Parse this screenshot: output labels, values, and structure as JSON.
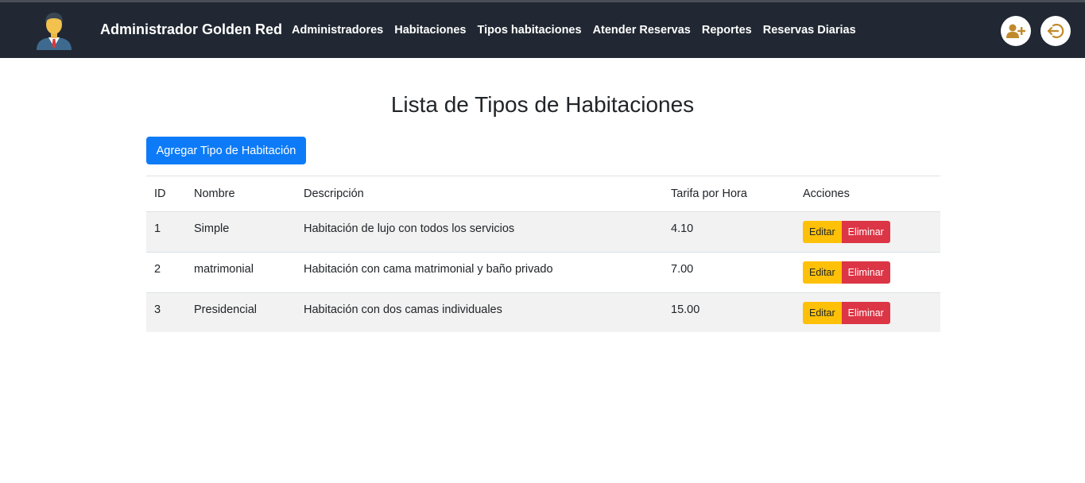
{
  "navbar": {
    "brand": "Administrador Golden Red",
    "links": [
      "Administradores",
      "Habitaciones",
      "Tipos habitaciones",
      "Atender Reservas",
      "Reportes",
      "Reservas Diarias"
    ],
    "add_user_icon": "user-plus-icon",
    "logout_icon": "logout-icon",
    "accent_color": "#c08a2a"
  },
  "main": {
    "title": "Lista de Tipos de Habitaciones",
    "add_button": "Agregar Tipo de Habitación",
    "table": {
      "headers": [
        "ID",
        "Nombre",
        "Descripción",
        "Tarifa por Hora",
        "Acciones"
      ],
      "rows": [
        {
          "id": "1",
          "nombre": "Simple",
          "descripcion": "Habitación de lujo con todos los servicios",
          "tarifa": "4.10"
        },
        {
          "id": "2",
          "nombre": "matrimonial",
          "descripcion": "Habitación con cama matrimonial y baño privado",
          "tarifa": "7.00"
        },
        {
          "id": "3",
          "nombre": "Presidencial",
          "descripcion": "Habitación con dos camas individuales",
          "tarifa": "15.00"
        }
      ],
      "edit_label": "Editar",
      "delete_label": "Eliminar"
    }
  }
}
